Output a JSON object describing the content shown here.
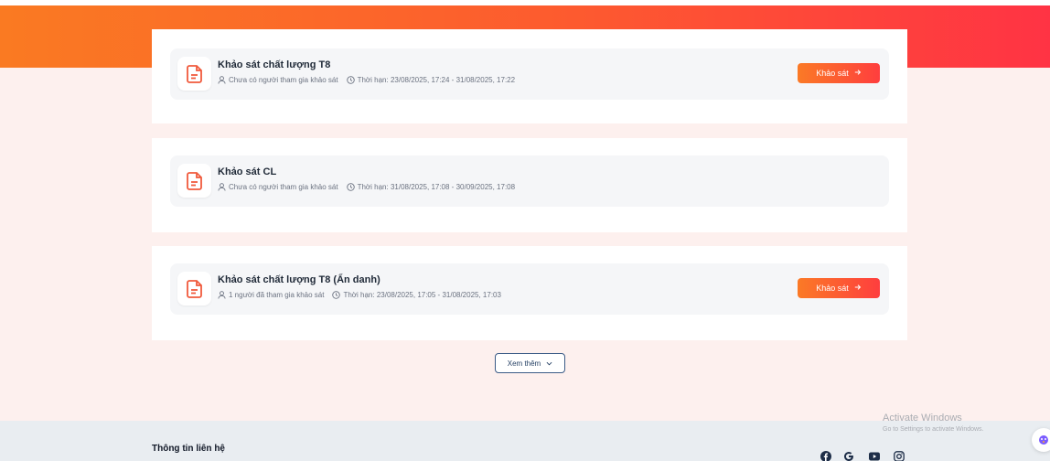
{
  "surveys": [
    {
      "title": "Khảo sát chất lượng T8",
      "participants": "Chưa có người tham gia khảo sát",
      "deadline": "Thời hạn: 23/08/2025, 17:24 - 31/08/2025, 17:22",
      "button_label": "Khảo sát"
    },
    {
      "title": "Khảo sát CL",
      "participants": "Chưa có người tham gia khảo sát",
      "deadline": "Thời hạn: 31/08/2025, 17:08 - 30/09/2025, 17:08"
    },
    {
      "title": "Khảo sát chất lượng T8 (Ẩn danh)",
      "participants": "1 người đã tham gia khảo sát",
      "deadline": "Thời hạn: 23/08/2025, 17:05 - 31/08/2025, 17:03",
      "button_label": "Khảo sát"
    }
  ],
  "load_more_label": "Xem thêm",
  "footer": {
    "title": "Thông tin liên hệ",
    "social": [
      "facebook-icon",
      "google-icon",
      "youtube-icon",
      "instagram-icon"
    ]
  },
  "watermark": {
    "line1": "Activate Windows",
    "line2": "Go to Settings to activate Windows."
  },
  "colors": {
    "brand_orange": "#fb7a26",
    "brand_red": "#fe3e3e",
    "page_bg": "#fdf0ee",
    "footer_bg": "#e9edf1",
    "icon_accent": "#f05a3c"
  }
}
